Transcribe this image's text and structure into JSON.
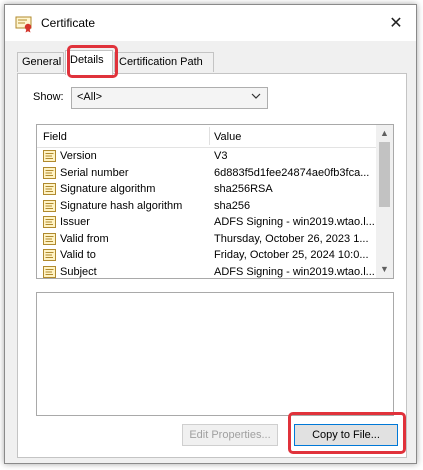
{
  "window": {
    "title": "Certificate",
    "close_glyph": "✕"
  },
  "tabs": [
    {
      "label": "General",
      "active": false
    },
    {
      "label": "Details",
      "active": true
    },
    {
      "label": "Certification Path",
      "active": false
    }
  ],
  "show": {
    "label": "Show:",
    "value": "<All>"
  },
  "fields_table": {
    "columns": [
      "Field",
      "Value"
    ],
    "rows": [
      {
        "field": "Version",
        "value": "V3"
      },
      {
        "field": "Serial number",
        "value": "6d883f5d1fee24874ae0fb3fca..."
      },
      {
        "field": "Signature algorithm",
        "value": "sha256RSA"
      },
      {
        "field": "Signature hash algorithm",
        "value": "sha256"
      },
      {
        "field": "Issuer",
        "value": "ADFS Signing - win2019.wtao.l..."
      },
      {
        "field": "Valid from",
        "value": "Thursday, October 26, 2023 1..."
      },
      {
        "field": "Valid to",
        "value": "Friday, October 25, 2024 10:0..."
      },
      {
        "field": "Subject",
        "value": "ADFS Signing - win2019.wtao.l..."
      }
    ]
  },
  "buttons": {
    "edit_properties": "Edit Properties...",
    "copy_to_file": "Copy to File..."
  },
  "colors": {
    "highlight": "#e0323b",
    "primary_border": "#0078d7"
  }
}
